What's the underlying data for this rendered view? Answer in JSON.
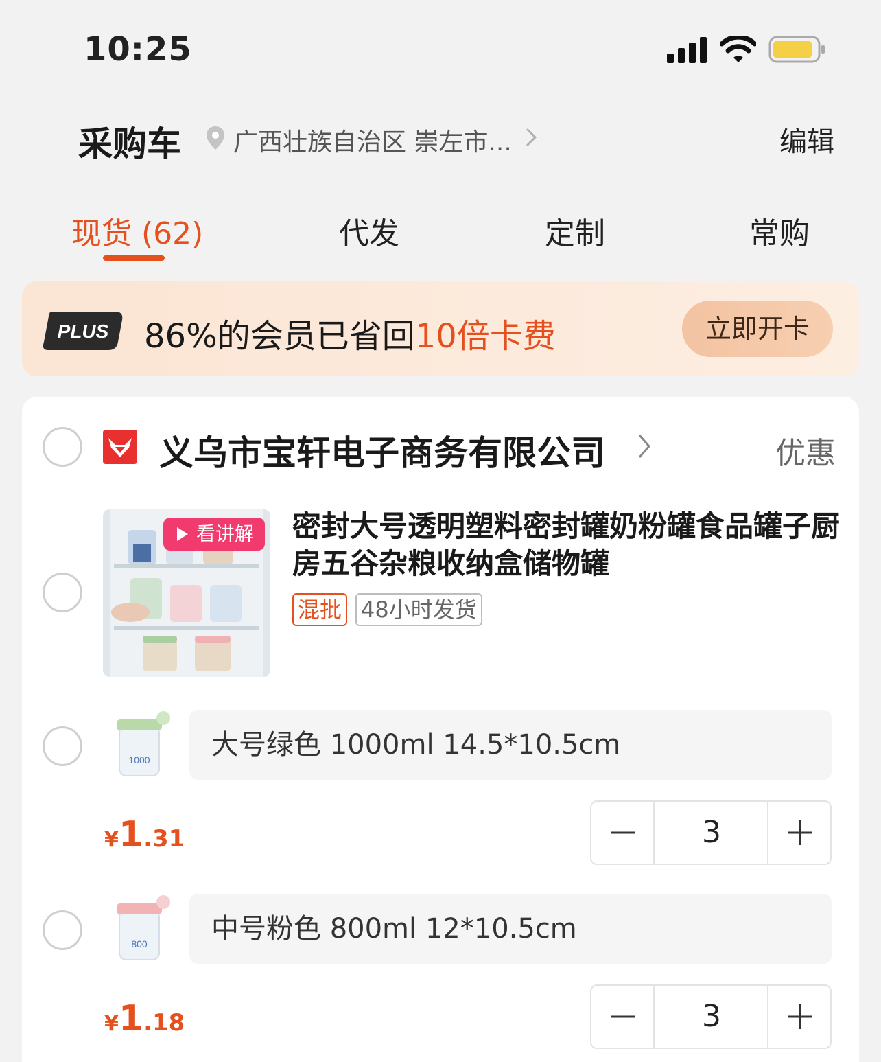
{
  "status": {
    "time": "10:25"
  },
  "header": {
    "title": "采购车",
    "address": "广西壮族自治区 崇左市...",
    "edit_label": "编辑"
  },
  "tabs": [
    {
      "label": "现货 (62)",
      "active": true
    },
    {
      "label": "代发"
    },
    {
      "label": "定制"
    },
    {
      "label": "常购"
    }
  ],
  "plus_banner": {
    "badge": "PLUS",
    "text_prefix": "86%的会员已省回",
    "text_highlight": "10倍卡费",
    "button_label": "立即开卡"
  },
  "store": {
    "name": "义乌市宝轩电子商务有限公司",
    "discount_label": "优惠",
    "product": {
      "video_badge": "看讲解",
      "title": "密封大号透明塑料密封罐奶粉罐食品罐子厨房五谷杂粮收纳盒储物罐",
      "tags": [
        "混批",
        "48小时发货"
      ],
      "skus": [
        {
          "spec": "大号绿色 1000ml 14.5*10.5cm",
          "currency": "¥",
          "price_int": "1",
          "price_dec": ".31",
          "quantity": "3",
          "thumb_label": "1000",
          "lid_color": "#b9d9a8"
        },
        {
          "spec": "中号粉色 800ml 12*10.5cm",
          "currency": "¥",
          "price_int": "1",
          "price_dec": ".18",
          "quantity": "3",
          "thumb_label": "800",
          "lid_color": "#f1b3b3"
        }
      ]
    }
  },
  "colors": {
    "accent": "#e5511e",
    "video_badge": "#f13b6f"
  }
}
